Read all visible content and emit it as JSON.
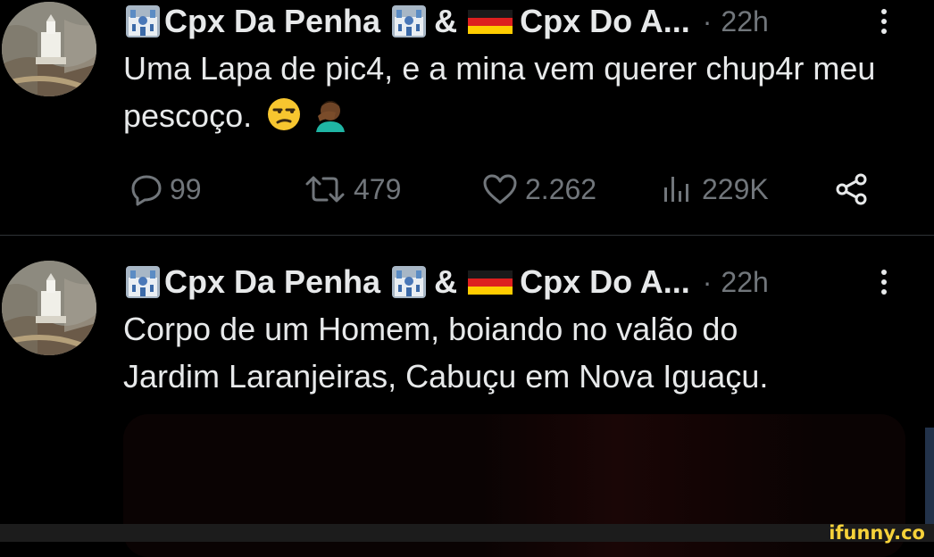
{
  "tweets": [
    {
      "author": {
        "name_part1": "Cpx Da Penha",
        "amp": "&",
        "name_part2": "Cpx Do A...",
        "time": "22h",
        "dot": "·"
      },
      "text": "Uma Lapa de pic4, e a mina vem querer chup4r meu pescoço.",
      "emojis": [
        "unamused-face",
        "facepalm"
      ],
      "actions": {
        "replies": "99",
        "reposts": "479",
        "likes": "2.262",
        "views": "229K"
      }
    },
    {
      "author": {
        "name_part1": "Cpx Da Penha",
        "amp": "&",
        "name_part2": "Cpx Do A...",
        "time": "22h",
        "dot": "·"
      },
      "line1": "Corpo de um Homem, boiando no valão do",
      "line2": "Jardim Laranjeiras, Cabuçu em Nova Iguaçu."
    }
  ],
  "watermark": "ifunny.co",
  "colors": {
    "background": "#000000",
    "text": "#e7e9ea",
    "muted": "#71767b",
    "divider": "#2f3336",
    "watermark": "#f6d23a"
  }
}
